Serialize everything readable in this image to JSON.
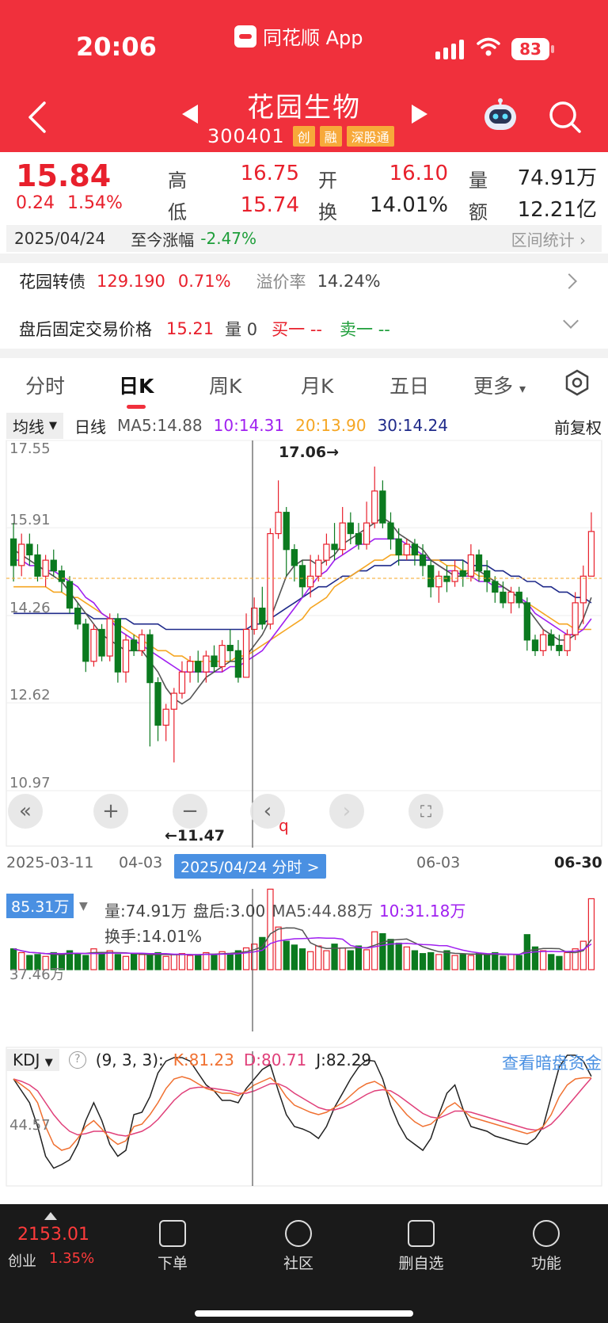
{
  "status_bar": {
    "time": "20:06",
    "app_name": "同花顺 App",
    "battery": "83"
  },
  "header": {
    "stock_name": "花园生物",
    "stock_code": "300401",
    "tags": [
      "创",
      "融",
      "深股通"
    ]
  },
  "quote": {
    "price": "15.84",
    "change": "0.24",
    "change_pct": "1.54%",
    "high_label": "高",
    "high": "16.75",
    "open_label": "开",
    "open": "16.10",
    "volume_label": "量",
    "volume": "74.91万",
    "low_label": "低",
    "low": "15.74",
    "turnover_label": "换",
    "turnover": "14.01%",
    "amount_label": "额",
    "amount": "12.21亿"
  },
  "date_bar": {
    "date": "2025/04/24",
    "label": "至今涨幅",
    "pct": "-2.47%",
    "stat_link": "区间统计"
  },
  "bond_row": {
    "name": "花园转债",
    "price": "129.190",
    "pct": "0.71%",
    "premium_label": "溢价率",
    "premium": "14.24%"
  },
  "after_row": {
    "label": "盘后固定交易价格",
    "price": "15.21",
    "vol": "量 0",
    "buy": "买一 --",
    "sell": "卖一 --"
  },
  "tabs": [
    "分时",
    "日K",
    "周K",
    "月K",
    "五日",
    "更多"
  ],
  "active_tab": "日K",
  "ma_row": {
    "select": "均线",
    "period": "日线",
    "ma5": "MA5:14.88",
    "ma10": "10:14.31",
    "ma20": "20:13.90",
    "ma30": "30:14.24",
    "adjust": "前复权"
  },
  "colors": {
    "up": "#e8202c",
    "down": "#0b7a1f",
    "ma5": "#555555",
    "ma10": "#a020f0",
    "ma20": "#f5a623",
    "ma30": "#1f2a8a",
    "accent": "#4a90e2"
  },
  "price_axis": {
    "ticks": [
      "17.55",
      "15.91",
      "14.26",
      "12.62",
      "10.97"
    ]
  },
  "annotations": {
    "high_label": "17.06→",
    "low_label": "←11.47"
  },
  "date_axis": {
    "start": "2025-03-11",
    "apr": "04-03",
    "selected": "2025/04/24 分时 >",
    "jun": "06-03",
    "end": "06-30"
  },
  "volume": {
    "max_tag": "85.31万",
    "vol": "量:74.91万",
    "after": "盘后:3.00",
    "ma5": "MA5:44.88万",
    "ma10": "10:31.18万",
    "turnover": "换手:14.01%",
    "axis_mid": "37.46万"
  },
  "kdj": {
    "select": "KDJ",
    "params": "(9, 3, 3):",
    "k": "K:81.23",
    "d": "D:80.71",
    "j": "J:82.29",
    "link": "查看暗盘资金",
    "axis_mid": "44.57"
  },
  "bottom": {
    "index_value": "2153.01",
    "index_name": "创业",
    "index_pct": "1.35%",
    "nav": [
      "下单",
      "社区",
      "删自选",
      "功能"
    ]
  },
  "chart_data": {
    "type": "candlestick",
    "ylim": [
      10.97,
      17.55
    ],
    "candles": [
      [
        15.7,
        15.2,
        16.0,
        14.9
      ],
      [
        15.2,
        15.6,
        15.8,
        15.0
      ],
      [
        15.6,
        15.4,
        15.8,
        15.2
      ],
      [
        15.4,
        15.0,
        15.6,
        14.9
      ],
      [
        15.0,
        15.3,
        15.4,
        14.8
      ],
      [
        15.3,
        15.1,
        15.5,
        15.0
      ],
      [
        15.1,
        14.9,
        15.2,
        14.7
      ],
      [
        14.9,
        14.4,
        15.0,
        14.3
      ],
      [
        14.4,
        14.1,
        14.5,
        14.0
      ],
      [
        14.1,
        13.4,
        14.2,
        13.2
      ],
      [
        13.4,
        14.0,
        14.1,
        13.3
      ],
      [
        14.0,
        13.5,
        14.1,
        13.4
      ],
      [
        13.5,
        14.2,
        14.3,
        13.4
      ],
      [
        14.2,
        13.2,
        14.3,
        13.0
      ],
      [
        13.2,
        13.8,
        13.9,
        13.0
      ],
      [
        13.8,
        13.6,
        13.9,
        13.5
      ],
      [
        13.6,
        13.9,
        14.0,
        13.5
      ],
      [
        13.9,
        13.0,
        14.0,
        11.8
      ],
      [
        13.0,
        12.2,
        13.1,
        11.9
      ],
      [
        12.2,
        12.5,
        12.6,
        11.9
      ],
      [
        12.5,
        12.8,
        12.9,
        11.5
      ],
      [
        12.8,
        13.2,
        13.4,
        12.7
      ],
      [
        13.2,
        13.4,
        13.5,
        13.0
      ],
      [
        13.4,
        13.2,
        13.6,
        13.0
      ],
      [
        13.2,
        13.5,
        13.6,
        13.0
      ],
      [
        13.5,
        13.3,
        13.7,
        13.2
      ],
      [
        13.3,
        13.7,
        13.8,
        13.2
      ],
      [
        13.7,
        13.6,
        14.0,
        13.4
      ],
      [
        13.6,
        13.1,
        13.8,
        13.0
      ],
      [
        13.1,
        14.0,
        14.3,
        13.1
      ],
      [
        14.0,
        14.4,
        14.6,
        13.9
      ],
      [
        14.4,
        14.1,
        14.8,
        14.0
      ],
      [
        14.1,
        15.8,
        15.9,
        14.0
      ],
      [
        15.8,
        16.2,
        16.8,
        15.7
      ],
      [
        16.2,
        15.5,
        16.3,
        15.0
      ],
      [
        15.5,
        15.2,
        15.6,
        14.9
      ],
      [
        15.2,
        14.8,
        15.3,
        14.6
      ],
      [
        14.8,
        15.0,
        15.4,
        14.6
      ],
      [
        15.0,
        15.3,
        15.4,
        14.9
      ],
      [
        15.3,
        15.6,
        15.8,
        15.2
      ],
      [
        15.6,
        15.5,
        16.0,
        15.3
      ],
      [
        15.5,
        16.0,
        16.3,
        15.4
      ],
      [
        16.0,
        15.8,
        16.2,
        15.6
      ],
      [
        15.8,
        15.6,
        16.0,
        15.5
      ],
      [
        15.6,
        16.0,
        16.4,
        15.5
      ],
      [
        16.0,
        16.6,
        17.06,
        15.9
      ],
      [
        16.6,
        16.0,
        16.8,
        15.9
      ],
      [
        16.0,
        15.7,
        16.2,
        15.5
      ],
      [
        15.7,
        15.4,
        15.9,
        15.2
      ],
      [
        15.4,
        15.6,
        15.7,
        15.3
      ],
      [
        15.6,
        15.4,
        15.7,
        15.2
      ],
      [
        15.4,
        15.2,
        15.6,
        15.0
      ],
      [
        15.2,
        14.8,
        15.3,
        14.6
      ],
      [
        14.8,
        15.0,
        15.1,
        14.5
      ],
      [
        15.0,
        14.9,
        15.2,
        14.7
      ],
      [
        14.9,
        15.1,
        15.3,
        14.8
      ],
      [
        15.1,
        15.0,
        15.3,
        14.8
      ],
      [
        15.0,
        15.4,
        15.6,
        14.9
      ],
      [
        15.4,
        15.1,
        15.5,
        14.9
      ],
      [
        15.1,
        14.9,
        15.3,
        14.7
      ],
      [
        14.9,
        14.7,
        15.0,
        14.5
      ],
      [
        14.7,
        14.5,
        14.9,
        14.4
      ],
      [
        14.5,
        14.7,
        14.8,
        14.3
      ],
      [
        14.7,
        14.5,
        14.8,
        14.4
      ],
      [
        14.5,
        13.8,
        14.6,
        13.6
      ],
      [
        13.8,
        13.6,
        13.9,
        13.5
      ],
      [
        13.6,
        13.9,
        14.0,
        13.5
      ],
      [
        13.9,
        13.7,
        14.0,
        13.6
      ],
      [
        13.7,
        13.6,
        13.9,
        13.5
      ],
      [
        13.6,
        13.9,
        14.0,
        13.5
      ],
      [
        13.9,
        14.5,
        14.7,
        13.8
      ],
      [
        14.5,
        15.0,
        15.2,
        14.1
      ],
      [
        15.0,
        15.84,
        16.2,
        15.74
      ]
    ],
    "ma5": [
      15.5,
      15.4,
      15.3,
      15.2,
      15.1,
      15.0,
      14.9,
      14.7,
      14.5,
      14.3,
      14.1,
      13.9,
      13.8,
      13.7,
      13.6,
      13.6,
      13.6,
      13.4,
      13.2,
      12.9,
      12.7,
      12.6,
      12.7,
      12.9,
      13.1,
      13.2,
      13.3,
      13.4,
      13.4,
      13.5,
      13.7,
      13.9,
      14.2,
      14.6,
      15.0,
      15.2,
      15.3,
      15.3,
      15.2,
      15.3,
      15.4,
      15.6,
      15.7,
      15.8,
      15.9,
      16.0,
      16.1,
      16.0,
      15.8,
      15.7,
      15.6,
      15.5,
      15.3,
      15.2,
      15.1,
      15.0,
      15.0,
      15.1,
      15.1,
      15.0,
      14.9,
      14.8,
      14.7,
      14.6,
      14.4,
      14.2,
      14.0,
      13.9,
      13.8,
      13.8,
      13.9,
      14.2,
      14.6
    ],
    "ma10": [
      15.3,
      15.3,
      15.2,
      15.2,
      15.1,
      15.1,
      15.0,
      14.9,
      14.8,
      14.6,
      14.5,
      14.3,
      14.2,
      14.0,
      13.9,
      13.8,
      13.7,
      13.6,
      13.5,
      13.4,
      13.3,
      13.2,
      13.2,
      13.2,
      13.2,
      13.2,
      13.2,
      13.3,
      13.3,
      13.4,
      13.5,
      13.6,
      13.8,
      14.0,
      14.2,
      14.4,
      14.6,
      14.8,
      15.0,
      15.1,
      15.3,
      15.4,
      15.5,
      15.6,
      15.6,
      15.7,
      15.7,
      15.7,
      15.7,
      15.6,
      15.5,
      15.4,
      15.3,
      15.2,
      15.1,
      15.1,
      15.0,
      15.0,
      14.9,
      14.9,
      14.8,
      14.8,
      14.7,
      14.6,
      14.5,
      14.3,
      14.2,
      14.1,
      14.0,
      13.9,
      13.9,
      14.0,
      14.2
    ],
    "ma20": [
      14.8,
      14.8,
      14.8,
      14.8,
      14.8,
      14.7,
      14.7,
      14.6,
      14.6,
      14.5,
      14.4,
      14.3,
      14.2,
      14.1,
      14.0,
      13.9,
      13.8,
      13.7,
      13.6,
      13.6,
      13.5,
      13.5,
      13.4,
      13.4,
      13.4,
      13.4,
      13.4,
      13.4,
      13.5,
      13.5,
      13.6,
      13.7,
      13.8,
      13.9,
      14.0,
      14.1,
      14.2,
      14.4,
      14.5,
      14.6,
      14.8,
      14.9,
      15.0,
      15.1,
      15.2,
      15.3,
      15.3,
      15.4,
      15.4,
      15.4,
      15.4,
      15.4,
      15.3,
      15.3,
      15.2,
      15.2,
      15.1,
      15.1,
      15.0,
      15.0,
      14.9,
      14.8,
      14.7,
      14.6,
      14.5,
      14.4,
      14.3,
      14.2,
      14.1,
      14.1,
      14.0,
      14.0,
      14.0
    ],
    "ma30": [
      14.3,
      14.3,
      14.3,
      14.3,
      14.3,
      14.3,
      14.3,
      14.3,
      14.3,
      14.3,
      14.2,
      14.2,
      14.2,
      14.2,
      14.2,
      14.1,
      14.1,
      14.1,
      14.1,
      14.0,
      14.0,
      14.0,
      14.0,
      14.0,
      14.0,
      14.0,
      14.0,
      14.0,
      14.0,
      14.0,
      14.1,
      14.1,
      14.2,
      14.3,
      14.4,
      14.5,
      14.6,
      14.7,
      14.8,
      14.8,
      14.9,
      15.0,
      15.0,
      15.1,
      15.1,
      15.2,
      15.2,
      15.2,
      15.3,
      15.3,
      15.3,
      15.3,
      15.3,
      15.3,
      15.3,
      15.3,
      15.3,
      15.2,
      15.2,
      15.2,
      15.1,
      15.1,
      15.0,
      15.0,
      14.9,
      14.9,
      14.8,
      14.8,
      14.7,
      14.7,
      14.6,
      14.6,
      14.5
    ],
    "volume": [
      22,
      18,
      15,
      16,
      14,
      18,
      16,
      20,
      17,
      15,
      22,
      17,
      20,
      16,
      14,
      17,
      16,
      15,
      18,
      14,
      16,
      17,
      15,
      16,
      18,
      16,
      19,
      17,
      20,
      23,
      27,
      34,
      85,
      45,
      30,
      26,
      22,
      19,
      25,
      20,
      27,
      23,
      20,
      25,
      21,
      40,
      38,
      32,
      28,
      24,
      20,
      17,
      18,
      16,
      20,
      15,
      16,
      15,
      17,
      16,
      18,
      14,
      16,
      15,
      37,
      24,
      20,
      16,
      14,
      18,
      22,
      30,
      74.91
    ],
    "k": [
      80,
      75,
      70,
      60,
      40,
      25,
      20,
      22,
      30,
      40,
      45,
      38,
      30,
      25,
      28,
      40,
      42,
      50,
      60,
      72,
      80,
      82,
      80,
      76,
      72,
      70,
      68,
      68,
      66,
      70,
      75,
      78,
      81,
      75,
      65,
      58,
      55,
      52,
      50,
      52,
      56,
      60,
      66,
      72,
      76,
      78,
      74,
      66,
      58,
      50,
      44,
      40,
      42,
      48,
      56,
      60,
      54,
      48,
      46,
      44,
      42,
      40,
      38,
      36,
      34,
      36,
      40,
      50,
      65,
      75,
      80,
      81,
      81
    ],
    "d": [
      80,
      78,
      75,
      70,
      60,
      50,
      42,
      36,
      33,
      34,
      36,
      36,
      35,
      33,
      32,
      34,
      36,
      40,
      46,
      54,
      62,
      68,
      72,
      73,
      73,
      72,
      71,
      70,
      68,
      68,
      70,
      73,
      76,
      76,
      73,
      68,
      64,
      60,
      56,
      54,
      54,
      56,
      59,
      63,
      67,
      70,
      71,
      70,
      66,
      61,
      56,
      51,
      48,
      47,
      50,
      53,
      53,
      52,
      50,
      48,
      46,
      44,
      42,
      40,
      38,
      37,
      38,
      42,
      49,
      57,
      65,
      73,
      80.71
    ],
    "j": [
      80,
      70,
      60,
      40,
      15,
      5,
      8,
      12,
      25,
      45,
      60,
      45,
      25,
      15,
      20,
      50,
      52,
      65,
      85,
      95,
      98,
      98,
      95,
      85,
      75,
      70,
      62,
      62,
      60,
      72,
      80,
      88,
      92,
      70,
      50,
      40,
      38,
      35,
      30,
      40,
      56,
      68,
      80,
      90,
      96,
      95,
      80,
      58,
      42,
      30,
      25,
      20,
      30,
      50,
      68,
      75,
      55,
      40,
      38,
      36,
      32,
      30,
      28,
      26,
      25,
      30,
      40,
      65,
      90,
      100,
      100,
      95,
      82.29
    ]
  }
}
